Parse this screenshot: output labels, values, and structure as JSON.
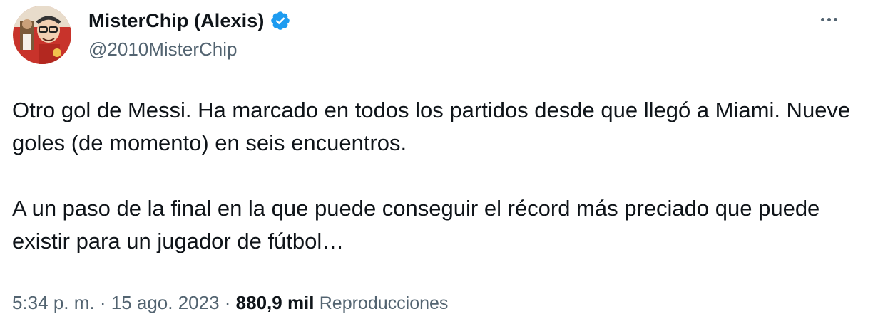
{
  "author": {
    "display_name": "MisterChip (Alexis)",
    "handle": "@2010MisterChip",
    "verified": true,
    "avatar_icon": "cartoon-avatar-icon",
    "verified_icon": "verified-badge-icon",
    "accent_color": "#1d9bf0"
  },
  "menu": {
    "icon": "more-options-icon"
  },
  "tweet": {
    "paragraph_1": "Otro gol de Messi. Ha marcado en todos los partidos desde que llegó a Miami. Nueve goles (de momento) en seis encuentros.",
    "paragraph_2": "A un paso de la final en la que puede conseguir el récord más preciado que puede existir para un jugador de fútbol…"
  },
  "meta": {
    "time": "5:34 p. m.",
    "separator": " · ",
    "date": "15 ago. 2023",
    "views_count": "880,9 mil",
    "views_label": "Reproducciones"
  }
}
